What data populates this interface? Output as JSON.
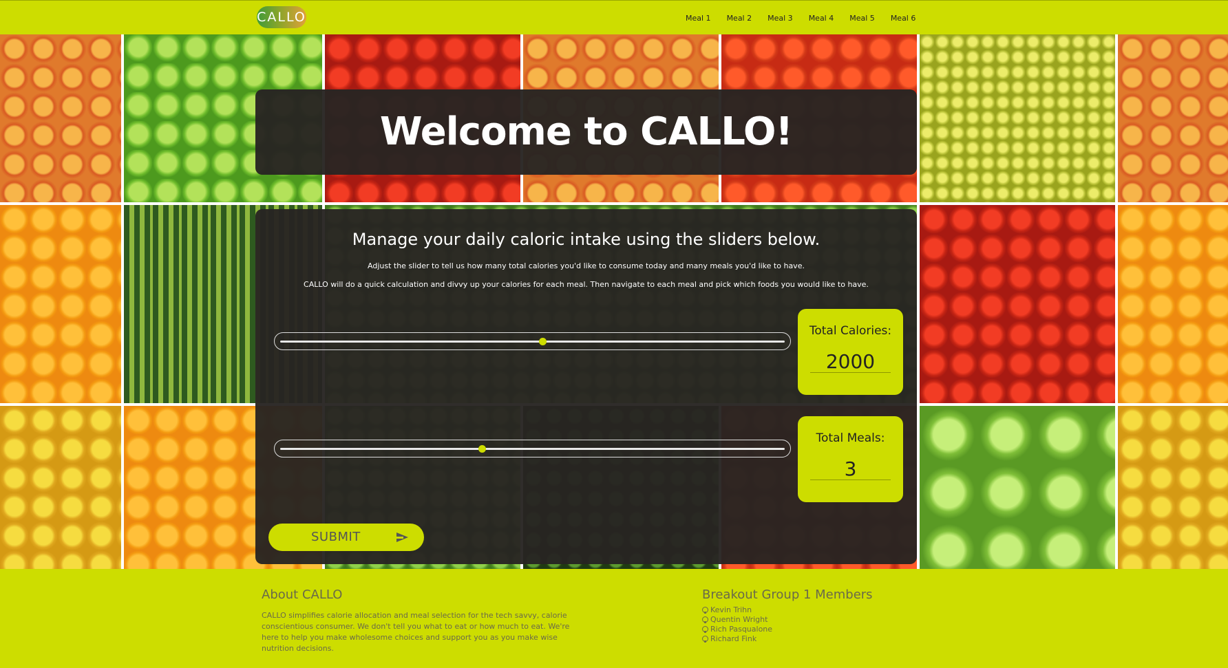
{
  "nav": {
    "brand": "CALLO",
    "links": [
      "Meal 1",
      "Meal 2",
      "Meal 3",
      "Meal 4",
      "Meal 5",
      "Meal 6"
    ]
  },
  "title": "Welcome to CALLO!",
  "intro": {
    "heading": "Manage your daily caloric intake using the sliders below.",
    "line1": "Adjust the slider to tell us how many total calories you'd like to consume today and many meals you'd like to have.",
    "line2": "CALLO will do a quick calculation and divvy up your calories for each meal. Then navigate to each meal and pick which foods you would like to have."
  },
  "calories": {
    "label": "Total Calories:",
    "value": "2000",
    "slider_fraction": 0.52
  },
  "meals": {
    "label": "Total Meals:",
    "value": "3",
    "slider_fraction": 0.4
  },
  "submit": {
    "label": "SUBMIT",
    "icon": "send-icon"
  },
  "footer": {
    "about_heading": "About CALLO",
    "about_text": "CALLO simplifies calorie allocation and meal selection for the tech savvy, calorie conscientious consumer. We don't tell you what to eat or how much to eat. We're here to help you make wholesome choices and support you as you make wise nutrition decisions.",
    "members_heading": "Breakout Group 1 Members",
    "members": [
      "Kevin Trihn",
      "Quentin Wright",
      "Rich Pasqualone",
      "Richard Fink"
    ],
    "member_icon": "github-icon"
  },
  "colors": {
    "accent": "#cddd00",
    "card": "#282422"
  }
}
